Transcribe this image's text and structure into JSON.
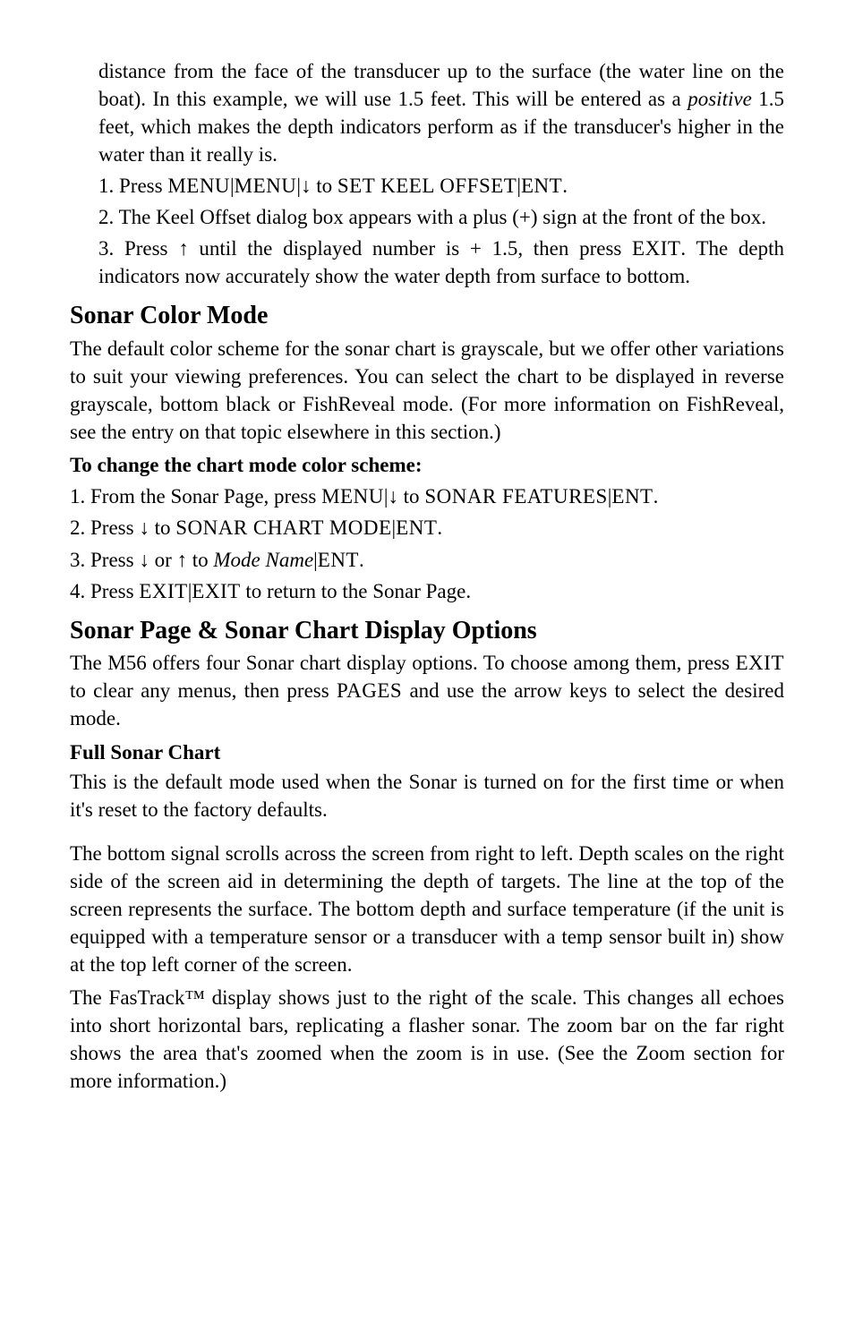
{
  "intro": {
    "p1a": "distance from the face of the transducer up to the surface (the water line on the boat). In this example, we will use 1.5 feet. This will be entered as a ",
    "p1b": "positive",
    "p1c": " 1.5 feet, which makes the depth indicators perform as if the transducer's higher in the water than it really is."
  },
  "steps_a": {
    "s1a": "1. Press ",
    "s1b": "MENU",
    "s1c": "|",
    "s1d": "MENU",
    "s1e": "|",
    "s1f": "↓",
    "s1g": " to ",
    "s1h": "SET KEEL OFFSET",
    "s1i": "|",
    "s1j": "ENT",
    "s1k": ".",
    "s2": "2. The Keel Offset dialog box appears with a plus (+) sign at the front of the box.",
    "s3a": "3. Press ",
    "s3b": "↑",
    "s3c": " until the displayed number is + 1.5, then press ",
    "s3d": "EXIT",
    "s3e": ". The depth indicators now accurately show the water depth from surface to bottom."
  },
  "color_mode": {
    "h": "Sonar Color Mode",
    "p": "The default color scheme for the sonar chart is grayscale, but we offer other variations to suit your viewing preferences. You can select the chart to be displayed in reverse grayscale, bottom black or FishReveal mode. (For more information on FishReveal, see the entry on that topic elsewhere in this section.)",
    "h3": "To change the chart mode color scheme:",
    "s1a": "1. From the Sonar Page, press ",
    "s1b": "MENU",
    "s1c": "|",
    "s1d": "↓",
    "s1e": " to ",
    "s1f": "SONAR FEATURES",
    "s1g": "|",
    "s1h": "ENT",
    "s1i": ".",
    "s2a": "2. Press ",
    "s2b": "↓",
    "s2c": " to ",
    "s2d": "SONAR CHART MODE",
    "s2e": "|",
    "s2f": "ENT",
    "s2g": ".",
    "s3a": "3. Press ",
    "s3b": "↓",
    "s3c": " or ",
    "s3d": "↑",
    "s3e": " to ",
    "s3f": "Mode Name",
    "s3g": "|",
    "s3h": "ENT",
    "s3i": ".",
    "s4a": "4. Press ",
    "s4b": "EXIT",
    "s4c": "|",
    "s4d": "EXIT",
    "s4e": " to return to the Sonar Page."
  },
  "display_options": {
    "h": "Sonar Page & Sonar Chart Display Options",
    "p1a": "The M56 offers four Sonar chart display options. To choose among them, press ",
    "p1b": "EXIT",
    "p1c": " to clear any menus, then press ",
    "p1d": "PAGES",
    "p1e": " and use the arrow keys to select the desired mode.",
    "h3": "Full Sonar Chart",
    "p2": "This is the default mode used when the Sonar is turned on for the first time or when it's reset to the factory defaults.",
    "p3": "The bottom signal scrolls across the screen from right to left. Depth scales on the right side of the screen aid in determining the depth of targets. The line at the top of the screen represents the surface. The bottom depth and surface temperature (if the unit is equipped with a temperature sensor or a transducer with a temp sensor built in) show at the top left corner of the screen.",
    "p4": "The FasTrack™ display shows just to the right of the scale. This changes all echoes into short horizontal bars, replicating a flasher sonar. The zoom bar on the far right shows the area that's zoomed when the zoom is in use. (See the Zoom section for more information.)"
  }
}
